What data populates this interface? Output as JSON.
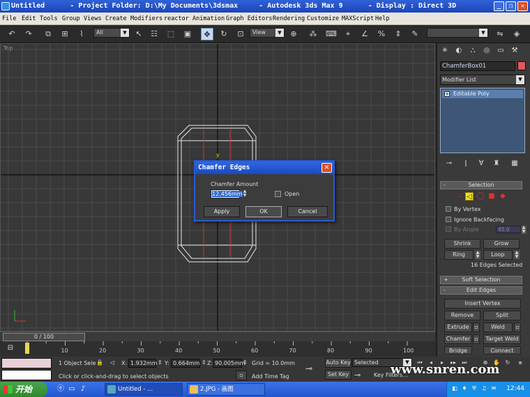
{
  "window": {
    "title": "Untitled      - Project Folder: D:\\My Documents\\3dsmax     - Autodesk 3ds Max 9      - Display : Direct 3D",
    "controls": [
      "minimize-icon",
      "maximize-icon",
      "close-icon"
    ]
  },
  "menu": [
    "File",
    "Edit",
    "Tools",
    "Group",
    "Views",
    "Create",
    "Modifiers",
    "reactor",
    "Animation",
    "Graph Editors",
    "Rendering",
    "Customize",
    "MAXScript",
    "Help"
  ],
  "toolbar": {
    "selection_filter": "All",
    "ref_coord": "View",
    "named_selection": ""
  },
  "viewport": {
    "label": "Top",
    "axis_label": "y"
  },
  "dialog": {
    "title": "Chamfer Edges",
    "amount_label": "Chamfer Amount",
    "amount_value": "12.456mm",
    "open_label": "Open",
    "apply": "Apply",
    "ok": "OK",
    "cancel": "Cancel"
  },
  "panel": {
    "object_name": "ChamferBox01",
    "object_color": "#e05858",
    "modifier_list": "Modifier List",
    "stack_item": "Editable Poly",
    "selection_header": "Selection",
    "by_vertex": "By Vertex",
    "ignore_backfacing": "Ignore Backfacing",
    "by_angle": "By Angle",
    "angle_value": "45.0",
    "shrink": "Shrink",
    "grow": "Grow",
    "ring": "Ring",
    "loop": "Loop",
    "selected_info": "16 Edges Selected",
    "soft_selection": "Soft Selection",
    "edit_edges": "Edit Edges",
    "insert_vertex": "Insert Vertex",
    "remove": "Remove",
    "split": "Split",
    "extrude": "Extrude",
    "weld": "Weld",
    "chamfer": "Chamfer",
    "target_weld": "Target Weld",
    "bridge": "Bridge",
    "connect": "Connect"
  },
  "timeline": {
    "frame_display": "0 / 100",
    "ticks": [
      "10",
      "20",
      "30",
      "40",
      "50",
      "60",
      "70",
      "80",
      "90",
      "100"
    ]
  },
  "status": {
    "selection_count": "1 Object Sele",
    "x_label": "X:",
    "x_value": "1.932mm",
    "y_label": "Y:",
    "y_value": "0.664mm",
    "z_label": "Z:",
    "z_value": "90.005mm",
    "grid": "Grid = 10.0mm",
    "prompt": "Click or click-and-drag to select objects",
    "add_time_tag": "Add Time Tag",
    "auto_key": "Auto Key",
    "set_key": "Set Key",
    "key_filters": "Key Filters...",
    "key_mode": "Selected"
  },
  "taskbar": {
    "start": "开始",
    "tasks": [
      "Untitled  - ...",
      "2.JPG - 画图"
    ],
    "clock": "12:44"
  },
  "watermark": "www.snren.com",
  "colors": {
    "viewport_bg": "#383838",
    "grid_line": "#4a4a4a",
    "axis_line": "#141414",
    "selected_edge": "#e03030",
    "wire": "#e8e8e8",
    "accent": "#2a5ad6"
  }
}
